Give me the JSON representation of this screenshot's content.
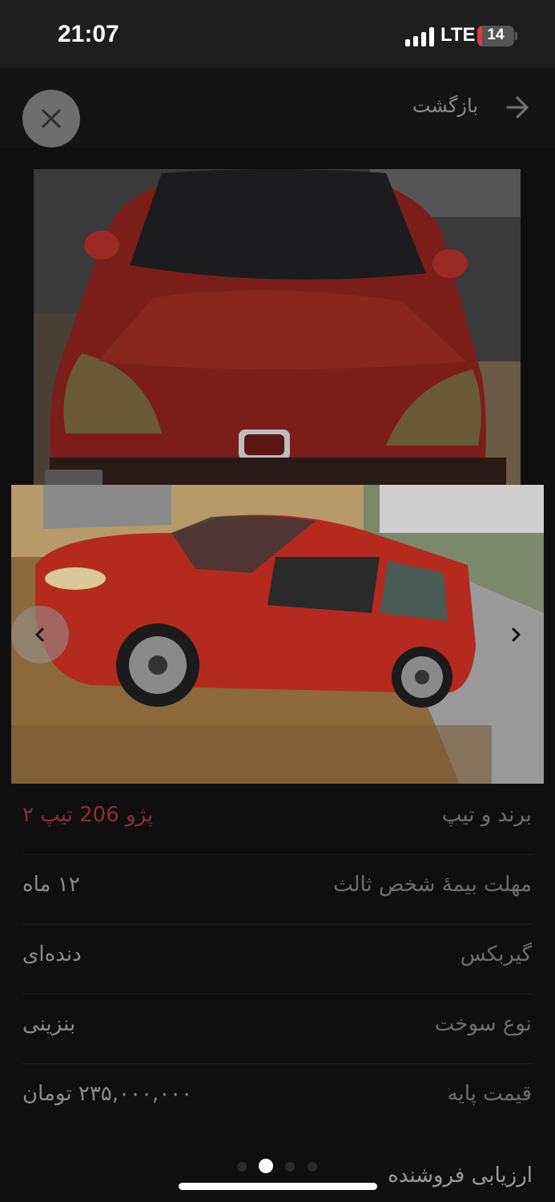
{
  "status_bar": {
    "time": "21:07",
    "network": "LTE",
    "battery": "14",
    "battery_level": 0.14,
    "battery_color": "#e5383b"
  },
  "header": {
    "back_label": "بازگشت",
    "back_icon": "arrow-right-icon",
    "close_icon": "close-icon"
  },
  "gallery": {
    "prev_icon": "chevron-left-icon",
    "next_icon": "chevron-right-icon",
    "current_index": 1,
    "total": 4
  },
  "details": [
    {
      "label": "برند و تیپ",
      "value": "پژو 206 تیپ ۲",
      "accent": true
    },
    {
      "label": "مهلت بیمهٔ شخص ثالث",
      "value": "۱۲ ماه"
    },
    {
      "label": "گیربکس",
      "value": "دنده‌ای"
    },
    {
      "label": "نوع سوخت",
      "value": "بنزینی"
    },
    {
      "label": "قیمت پایه",
      "value": "۲۳۵,۰۰۰,۰۰۰ تومان"
    }
  ],
  "seller": {
    "label": "ارزیابی فروشنده"
  },
  "colors": {
    "background": "#0f0f10",
    "accent": "#8b2f35"
  }
}
